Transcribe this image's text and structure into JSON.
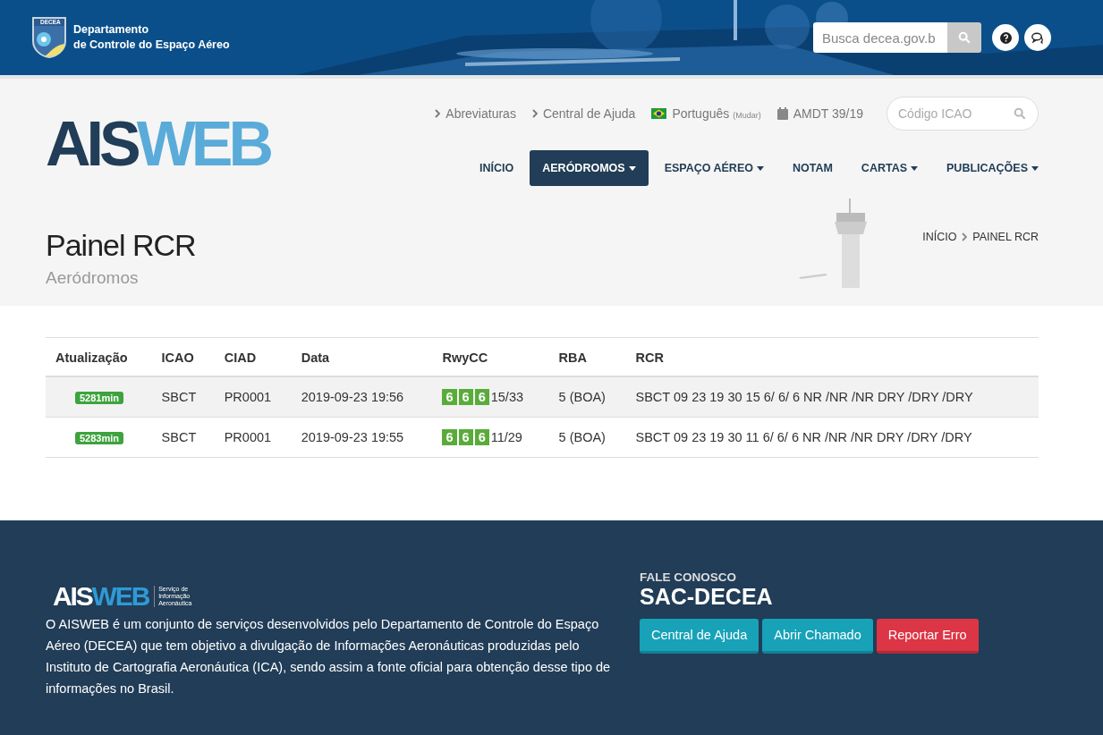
{
  "topbar": {
    "org_line1": "Departamento",
    "org_line2": "de Controle do Espaço Aéreo",
    "emblem_text": "DECEA",
    "search": {
      "placeholder": "Busca decea.gov.b"
    },
    "icons": [
      {
        "kind": "help"
      },
      {
        "kind": "chat"
      }
    ]
  },
  "header": {
    "logo_left": "AIS",
    "logo_right": "WEB",
    "links": [
      {
        "kind": "chevron",
        "label": "Abreviaturas"
      },
      {
        "kind": "chevron",
        "label": "Central de Ajuda"
      },
      {
        "kind": "flag",
        "label": "Português",
        "note": "(Mudar)"
      },
      {
        "kind": "calendar",
        "label": "AMDT 39/19"
      }
    ],
    "icao_search": {
      "placeholder": "Código ICAO"
    },
    "nav": [
      {
        "label": "INÍCIO",
        "dropdown": false,
        "selected": false
      },
      {
        "label": "AERÓDROMOS",
        "dropdown": true,
        "selected": true
      },
      {
        "label": "ESPAÇO AÉREO",
        "dropdown": true,
        "selected": false
      },
      {
        "label": "NOTAM",
        "dropdown": false,
        "selected": false
      },
      {
        "label": "CARTAS",
        "dropdown": true,
        "selected": false
      },
      {
        "label": "PUBLICAÇÕES",
        "dropdown": true,
        "selected": false
      }
    ]
  },
  "page": {
    "title": "Painel RCR",
    "subtitle": "Aeródromos",
    "breadcrumb": [
      "INÍCIO",
      "PAINEL RCR"
    ]
  },
  "table": {
    "columns": [
      "Atualização",
      "ICAO",
      "CIAD",
      "Data",
      "RwyCC",
      "RBA",
      "RCR"
    ],
    "rows": [
      {
        "highlighted": true,
        "age": "5281min",
        "icao": "SBCT",
        "ciad": "PR0001",
        "date": "2019-09-23 19:56",
        "rwycc": [
          "6",
          "6",
          "6"
        ],
        "runway": "15/33",
        "rba": "5 (BOA)",
        "rcr": "SBCT 09 23 19 30 15 6/ 6/ 6 NR /NR /NR DRY /DRY /DRY"
      },
      {
        "highlighted": false,
        "age": "5283min",
        "icao": "SBCT",
        "ciad": "PR0001",
        "date": "2019-09-23 19:55",
        "rwycc": [
          "6",
          "6",
          "6"
        ],
        "runway": "11/29",
        "rba": "5 (BOA)",
        "rcr": "SBCT 09 23 19 30 11 6/ 6/ 6 NR /NR /NR DRY /DRY /DRY"
      }
    ]
  },
  "footer": {
    "logo_left": "AIS",
    "logo_right": "WEB",
    "logo_tagline": "Serviço de Informação Aeronáutica",
    "about": "O AISWEB é um conjunto de serviços desenvolvidos pelo Departamento de Controle do Espaço Aéreo (DECEA) que tem objetivo a divulgação de Informações Aeronáuticas produzidas pelo Instituto de Cartografia Aeronáutica (ICA), sendo assim a fonte oficial para obtenção desse tipo de informações no Brasil.",
    "contact_label": "FALE CONOSCO",
    "contact_title": "SAC-DECEA",
    "buttons": [
      {
        "label": "Central de Ajuda",
        "kind": "info"
      },
      {
        "label": "Abrir Chamado",
        "kind": "info"
      },
      {
        "label": "Reportar Erro",
        "kind": "danger"
      }
    ]
  }
}
